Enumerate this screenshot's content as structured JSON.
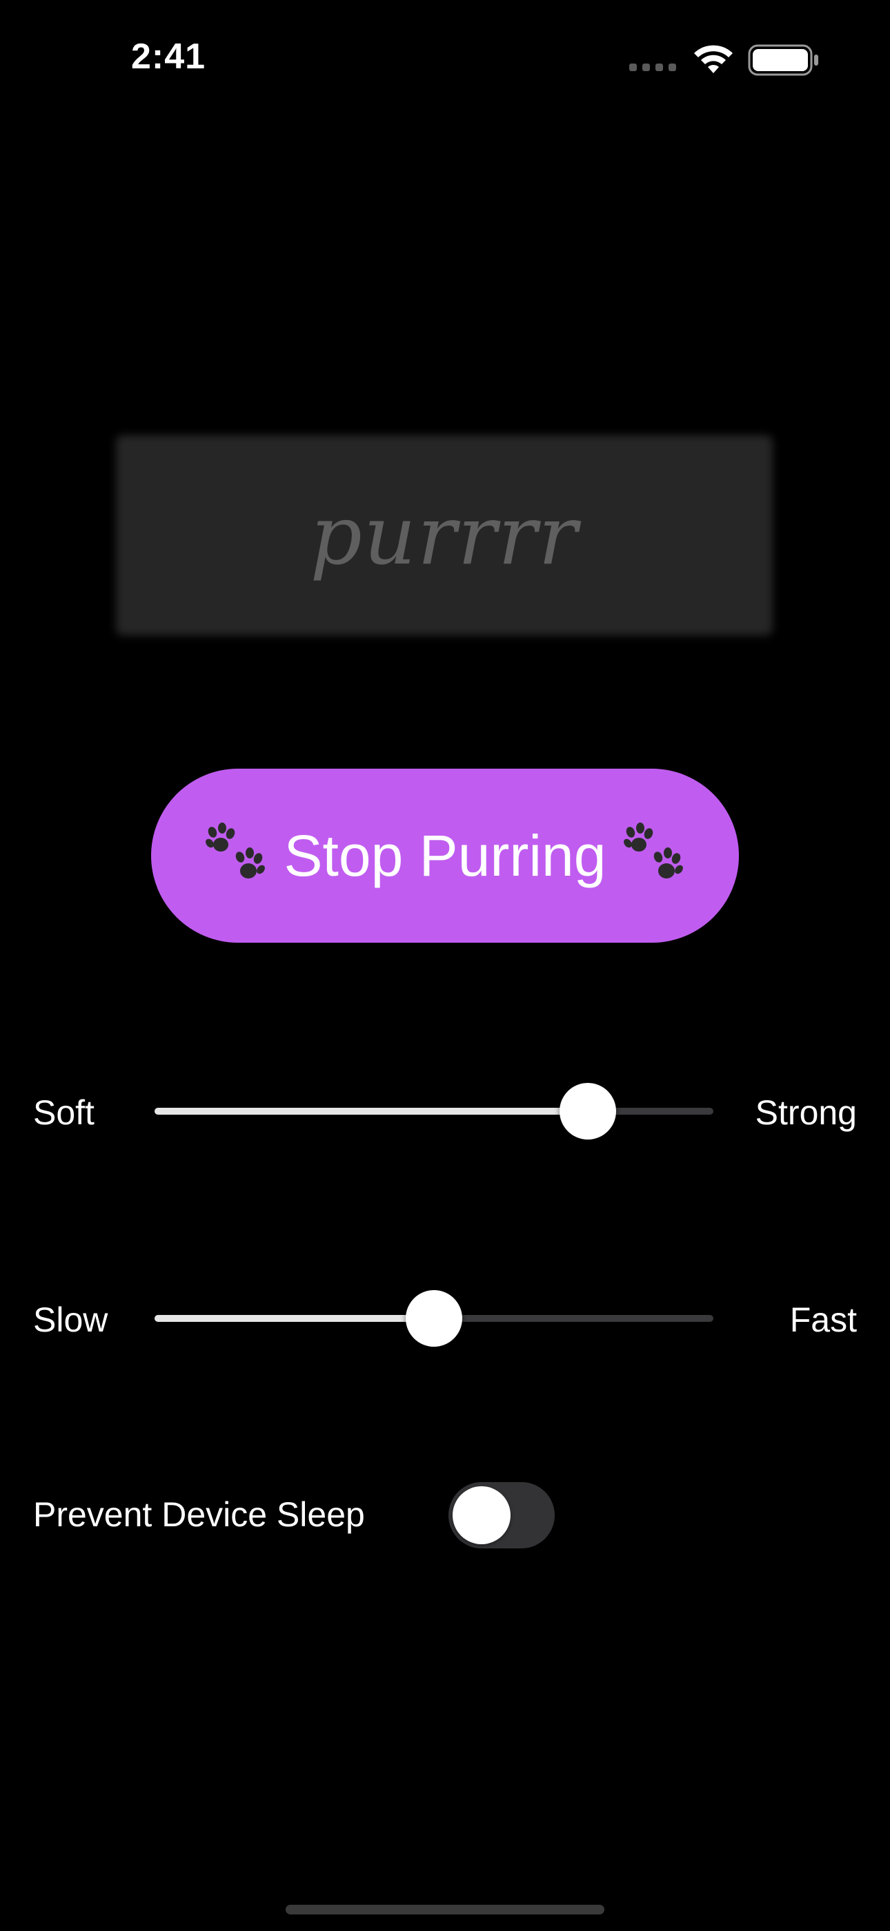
{
  "status_bar": {
    "time": "2:41"
  },
  "purr_display": {
    "text": "purrrr"
  },
  "stop_button": {
    "label": "Stop Purring",
    "color": "#c05df0"
  },
  "strength_slider": {
    "min_label": "Soft",
    "max_label": "Strong",
    "value_fraction": 0.775
  },
  "speed_slider": {
    "min_label": "Slow",
    "max_label": "Fast",
    "value_fraction": 0.5
  },
  "sleep_toggle": {
    "label": "Prevent Device Sleep",
    "on": false
  },
  "icons": {
    "paw": "paw-prints-icon",
    "wifi": "wifi-icon",
    "battery": "battery-icon",
    "signal": "cellular-signal-icon"
  }
}
